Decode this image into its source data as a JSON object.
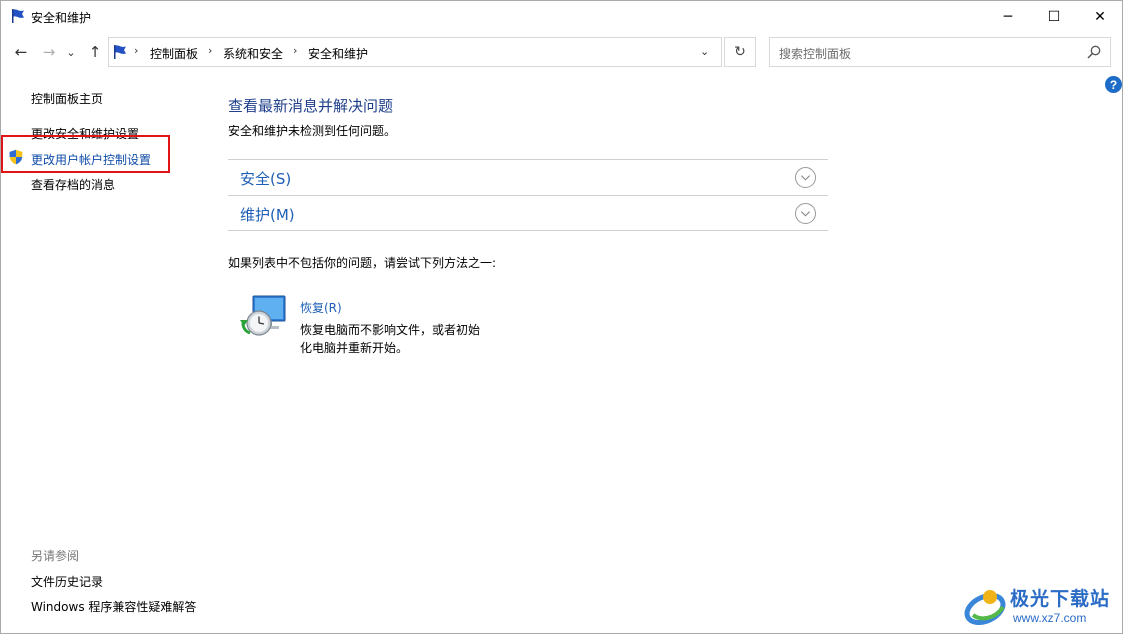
{
  "window": {
    "title": "安全和维护",
    "minimize_glyph": "─",
    "maximize_glyph": "☐",
    "close_glyph": "✕"
  },
  "nav": {
    "back_icon": "←",
    "forward_icon": "→",
    "history_icon": "⌄",
    "up_icon": "↑",
    "breadcrumb": [
      "控制面板",
      "系统和安全",
      "安全和维护"
    ],
    "separator": "›",
    "dropdown_icon": "⌄",
    "refresh_icon": "↻"
  },
  "search": {
    "placeholder": "搜索控制面板"
  },
  "help": {
    "label": "?"
  },
  "sidebar": {
    "home": "控制面板主页",
    "items": [
      "更改安全和维护设置",
      "更改用户帐户控制设置",
      "查看存档的消息"
    ],
    "see_also_heading": "另请参阅",
    "see_also": [
      "文件历史记录",
      "Windows 程序兼容性疑难解答"
    ]
  },
  "main": {
    "title": "查看最新消息并解决问题",
    "subtitle": "安全和维护未检测到任何问题。",
    "sections": [
      {
        "label": "安全(S)"
      },
      {
        "label": "维护(M)"
      }
    ],
    "hint": "如果列表中不包括你的问题，请尝试下列方法之一:",
    "recovery": {
      "title": "恢复(R)",
      "desc_line1": "恢复电脑而不影响文件，或者初始",
      "desc_line2": "化电脑并重新开始。"
    }
  },
  "watermark": {
    "name": "极光下载站",
    "url": "www.xz7.com"
  },
  "colors": {
    "link": "#0d4ba8",
    "title": "#1e3f8a",
    "highlight_box": "#e01414",
    "help": "#1d6cc7"
  }
}
